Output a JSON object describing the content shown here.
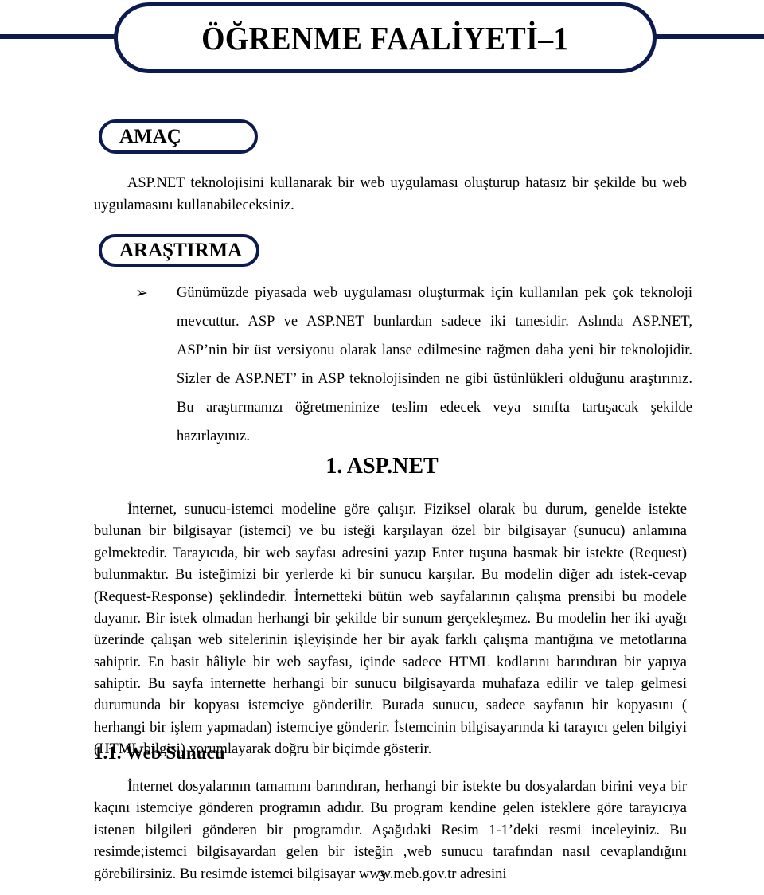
{
  "document": {
    "banner": {
      "title": "ÖĞRENME FAALİYETİ–1"
    },
    "sections": [
      {
        "label": "AMAÇ",
        "body": "ASP.NET teknolojisini kullanarak bir web uygulaması oluşturup hatasız bir şekilde bu web uygulamasını kullanabileceksiniz."
      },
      {
        "label": "ARAŞTIRMA",
        "bullet_icon": "➢",
        "bullet_text": "Günümüzde piyasada web uygulaması oluşturmak için kullanılan pek çok teknoloji mevcuttur. ASP ve ASP.NET bunlardan sadece iki tanesidir. Aslında ASP.NET, ASP’nin bir üst versiyonu olarak lanse edilmesine rağmen daha yeni bir teknolojidir. Sizler de ASP.NET’ in ASP teknolojisinden ne gibi üstünlükleri olduğunu araştırınız. Bu araştırmanızı öğretmeninize teslim edecek veya sınıfta tartışacak şekilde hazırlayınız."
      }
    ],
    "headings": {
      "chapter": "1. ASP.NET",
      "subsection": "1.1. Web Sunucu"
    },
    "paragraphs": {
      "asp_net_intro": "İnternet, sunucu-istemci modeline göre çalışır. Fiziksel olarak bu durum, genelde istekte bulunan bir bilgisayar (istemci) ve bu isteği karşılayan özel bir bilgisayar (sunucu) anlamına gelmektedir. Tarayıcıda, bir web sayfası adresini yazıp Enter tuşuna basmak bir istekte (Request) bulunmaktır. Bu isteğimizi bir yerlerde ki bir sunucu karşılar. Bu modelin diğer adı istek-cevap (Request-Response) şeklindedir. İnternetteki bütün web sayfalarının çalışma prensibi bu modele dayanır. Bir istek olmadan herhangi bir şekilde bir sunum gerçekleşmez.  Bu modelin her iki ayağı üzerinde çalışan web sitelerinin işleyişinde her bir ayak farklı çalışma mantığına ve metotlarına sahiptir. En basit hâliyle bir web sayfası, içinde sadece HTML kodlarını barındıran bir yapıya sahiptir. Bu sayfa internette herhangi bir sunucu bilgisayarda muhafaza edilir ve talep gelmesi durumunda bir kopyası istemciye gönderilir. Burada sunucu, sadece sayfanın bir kopyasını ( herhangi bir işlem yapmadan) istemciye gönderir. İstemcinin bilgisayarında ki tarayıcı gelen bilgiyi (HTML bilgisi) yorumlayarak doğru bir biçimde gösterir.",
      "web_sunucu": "İnternet dosyalarının tamamını barındıran, herhangi bir istekte bu dosyalardan birini veya bir kaçını istemciye gönderen programın adıdır. Bu program kendine gelen isteklere göre tarayıcıya istenen bilgileri gönderen bir programdır. Aşağıdaki Resim 1-1’deki resmi inceleyiniz. Bu resimde;istemci bilgisayardan gelen bir isteğin ,web sunucu tarafından nasıl cevaplandığını görebilirsiniz. Bu resimde istemci bilgisayar www.meb.gov.tr adresini"
    },
    "footer": {
      "page_number": "3"
    },
    "colors": {
      "accent_navy": "#0d1a4f",
      "text": "#000000",
      "background": "#ffffff"
    }
  }
}
